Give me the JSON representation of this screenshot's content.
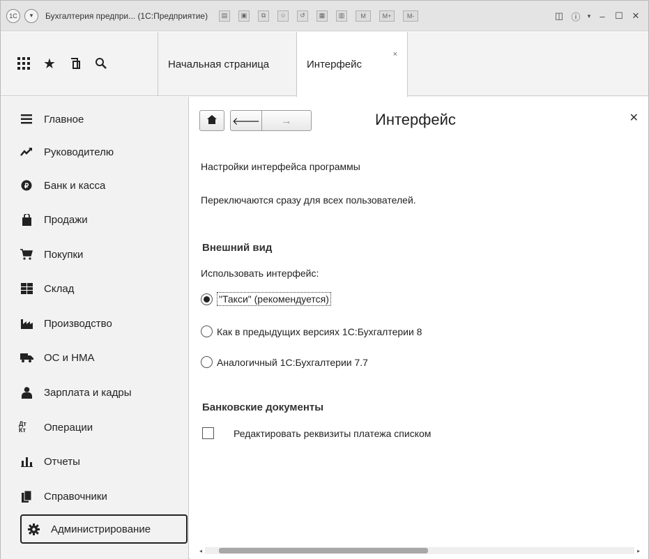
{
  "window": {
    "title": "Бухгалтерия предпри... (1С:Предприятие)"
  },
  "titlebar_icons": [
    "app-logo-icon",
    "menu-dropdown-icon",
    "toolbar-tool-icons",
    "info-icon",
    "minimize-icon",
    "maximize-icon",
    "close-icon"
  ],
  "toolbar": {
    "tabs": [
      {
        "label": "Начальная страница"
      },
      {
        "label": "Интерфейс",
        "active": true,
        "close": "×"
      }
    ]
  },
  "sidebar": {
    "items": [
      {
        "label": "Главное",
        "icon": "hamburger-icon"
      },
      {
        "label": "Руководителю",
        "icon": "trend-chart-icon"
      },
      {
        "label": "Банк и касса",
        "icon": "ruble-coin-icon"
      },
      {
        "label": "Продажи",
        "icon": "shopping-bag-icon"
      },
      {
        "label": "Покупки",
        "icon": "shopping-cart-icon"
      },
      {
        "label": "Склад",
        "icon": "warehouse-icon"
      },
      {
        "label": "Производство",
        "icon": "factory-icon"
      },
      {
        "label": "ОС и НМА",
        "icon": "truck-icon"
      },
      {
        "label": "Зарплата и кадры",
        "icon": "person-icon"
      },
      {
        "label": "Операции",
        "icon": "debit-credit-icon",
        "glyph": "Дт Кт"
      },
      {
        "label": "Отчеты",
        "icon": "bar-chart-icon"
      },
      {
        "label": "Справочники",
        "icon": "books-icon"
      },
      {
        "label": "Администрирование",
        "icon": "gear-icon",
        "selected": true
      }
    ]
  },
  "main": {
    "title": "Интерфейс",
    "subtitle": "Настройки интерфейса программы",
    "note": "Переключаются сразу для всех пользователей.",
    "appearance": {
      "heading": "Внешний вид",
      "label": "Использовать интерфейс:",
      "options": [
        {
          "label": "\"Такси\" (рекомендуется)",
          "selected": true
        },
        {
          "label": "Как в предыдущих версиях 1С:Бухгалтерии 8",
          "selected": false
        },
        {
          "label": "Аналогичный 1С:Бухгалтерии 7.7",
          "selected": false
        }
      ]
    },
    "bank_docs": {
      "heading": "Банковские документы",
      "checkbox_label": "Редактировать реквизиты платежа списком",
      "checked": false
    }
  }
}
